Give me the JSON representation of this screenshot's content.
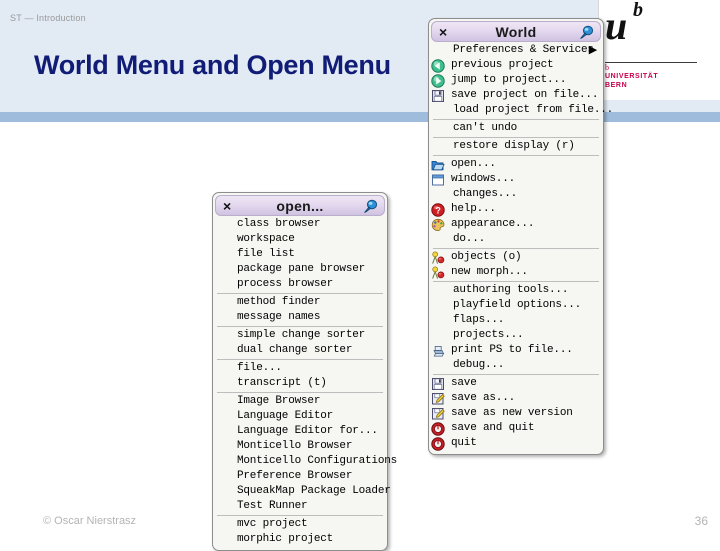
{
  "slide": {
    "breadcrumb": "ST — Introduction",
    "title": "World Menu and Open Menu",
    "copyright": "© Oscar Nierstrasz",
    "page_number": "36",
    "accent_color": "#101c75",
    "header_band_color": "#e2eaf4",
    "header_rule_color": "#9fbcdc"
  },
  "logo": {
    "u": "u",
    "b": "b",
    "tick": "b",
    "line1": "UNIVERSITÄT",
    "line2": "BERN",
    "color": "#c8004b"
  },
  "world_menu": {
    "title": "World",
    "close_label": "×",
    "pin_icon": "pin-icon",
    "items": [
      {
        "label": "Preferences & Services",
        "icon": null,
        "submenu": true,
        "arrow": "▶"
      },
      {
        "label": "previous project",
        "icon": "left-arrow-green-icon"
      },
      {
        "label": "jump to project...",
        "icon": "right-arrow-green-icon"
      },
      {
        "label": "save project on file...",
        "icon": "floppy-disk-icon"
      },
      {
        "label": "load project from file...",
        "icon": null
      },
      {
        "separator": true
      },
      {
        "label": "can't undo",
        "icon": null
      },
      {
        "separator": true
      },
      {
        "label": "restore display (r)",
        "icon": null
      },
      {
        "separator": true
      },
      {
        "label": "open...",
        "icon": "open-folder-icon"
      },
      {
        "label": "windows...",
        "icon": "window-icon"
      },
      {
        "label": "changes...",
        "icon": null
      },
      {
        "label": "help...",
        "icon": "help-red-icon"
      },
      {
        "label": "appearance...",
        "icon": "palette-icon"
      },
      {
        "label": "do...",
        "icon": null
      },
      {
        "separator": true
      },
      {
        "label": "objects (o)",
        "icon": "objects-icon"
      },
      {
        "label": "new morph...",
        "icon": "new-morph-icon"
      },
      {
        "separator": true
      },
      {
        "label": "authoring tools...",
        "icon": null
      },
      {
        "label": "playfield options...",
        "icon": null
      },
      {
        "label": "flaps...",
        "icon": null
      },
      {
        "label": "projects...",
        "icon": null
      },
      {
        "label": "print PS to file...",
        "icon": "printer-icon"
      },
      {
        "label": "debug...",
        "icon": null
      },
      {
        "separator": true
      },
      {
        "label": "save",
        "icon": "floppy-disk-icon"
      },
      {
        "label": "save as...",
        "icon": "floppy-pencil-icon"
      },
      {
        "label": "save as new version",
        "icon": "floppy-pencil-icon"
      },
      {
        "label": "save and quit",
        "icon": "power-red-icon"
      },
      {
        "label": "quit",
        "icon": "power-red-icon"
      }
    ]
  },
  "open_menu": {
    "title": "open...",
    "close_label": "×",
    "pin_icon": "pin-icon",
    "items": [
      {
        "label": "class browser"
      },
      {
        "label": "workspace"
      },
      {
        "label": "file list"
      },
      {
        "label": "package pane browser"
      },
      {
        "label": "process browser"
      },
      {
        "separator": true
      },
      {
        "label": "method finder"
      },
      {
        "label": "message names"
      },
      {
        "separator": true
      },
      {
        "label": "simple change sorter"
      },
      {
        "label": "dual change sorter"
      },
      {
        "separator": true
      },
      {
        "label": "file..."
      },
      {
        "label": "transcript (t)"
      },
      {
        "separator": true
      },
      {
        "label": "Image Browser"
      },
      {
        "label": "Language Editor"
      },
      {
        "label": "Language Editor for..."
      },
      {
        "label": "Monticello Browser"
      },
      {
        "label": "Monticello Configurations"
      },
      {
        "label": "Preference Browser"
      },
      {
        "label": "SqueakMap Package Loader"
      },
      {
        "label": "Test Runner"
      },
      {
        "separator": true
      },
      {
        "label": "mvc project"
      },
      {
        "label": "morphic project"
      }
    ]
  }
}
